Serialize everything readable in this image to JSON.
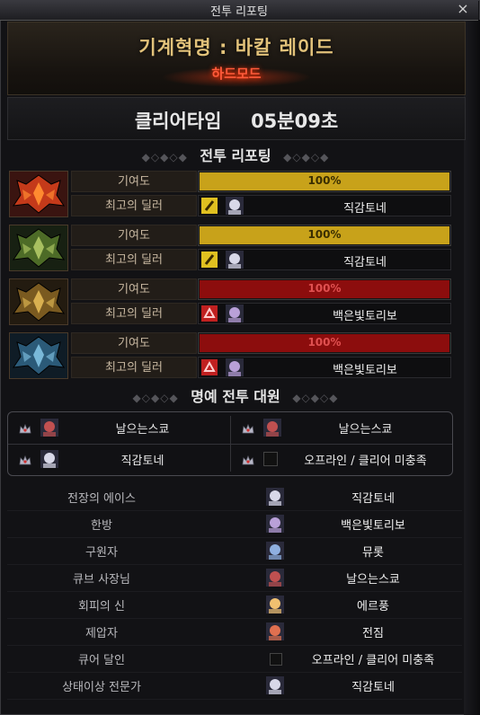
{
  "window": {
    "title": "전투 리포팅",
    "close_glyph": "×"
  },
  "header": {
    "mode_title": "기계혁명 : 바칼 레이드",
    "difficulty": "하드모드",
    "clear_time_label": "클리어타임",
    "clear_time_value": "05분09초"
  },
  "colors": {
    "contribution_gold": "#c8a21a",
    "contribution_red": "#8c0d0d",
    "title_gold": "#e2c27a",
    "hardmode_red": "#ff5a3a"
  },
  "report_section_title": "전투 리포팅",
  "report_rows": [
    {
      "boss_icon": "red-dragon-icon",
      "contribution_label": "기여도",
      "contribution_value": "100%",
      "bar_color": "gold",
      "best_dealer_label": "최고의 딜러",
      "job_icon": "yellow-slash-icon",
      "dealer_name": "직감토네"
    },
    {
      "boss_icon": "green-dragon-icon",
      "contribution_label": "기여도",
      "contribution_value": "100%",
      "bar_color": "gold",
      "best_dealer_label": "최고의 딜러",
      "job_icon": "yellow-slash-icon",
      "dealer_name": "직감토네"
    },
    {
      "boss_icon": "gold-dragon-icon",
      "contribution_label": "기여도",
      "contribution_value": "100%",
      "bar_color": "red",
      "best_dealer_label": "최고의 딜러",
      "job_icon": "red-class-icon",
      "dealer_name": "백은빛토리보"
    },
    {
      "boss_icon": "blue-dragon-icon",
      "contribution_label": "기여도",
      "contribution_value": "100%",
      "bar_color": "red",
      "best_dealer_label": "최고의 딜러",
      "job_icon": "red-class-icon",
      "dealer_name": "백은빛토리보"
    }
  ],
  "honor_section_title": "명예 전투 대원",
  "honor_members": [
    {
      "name": "날으는스쿄",
      "offline": false
    },
    {
      "name": "날으는스쿄",
      "offline": false
    },
    {
      "name": "직감토네",
      "offline": false
    },
    {
      "name": "오프라인 / 클리어 미충족",
      "offline": true
    }
  ],
  "awards": [
    {
      "title": "전장의 에이스",
      "name": "직감토네",
      "offline": false
    },
    {
      "title": "한방",
      "name": "백은빛토리보",
      "offline": false
    },
    {
      "title": "구원자",
      "name": "뮤롯",
      "offline": false
    },
    {
      "title": "큐브 사장님",
      "name": "날으는스쿄",
      "offline": false
    },
    {
      "title": "회피의 신",
      "name": "에르풍",
      "offline": false
    },
    {
      "title": "제압자",
      "name": "전짐",
      "offline": false
    },
    {
      "title": "큐어 달인",
      "name": "오프라인 / 클리어 미충족",
      "offline": true
    },
    {
      "title": "상태이상 전문가",
      "name": "직감토네",
      "offline": false
    }
  ]
}
